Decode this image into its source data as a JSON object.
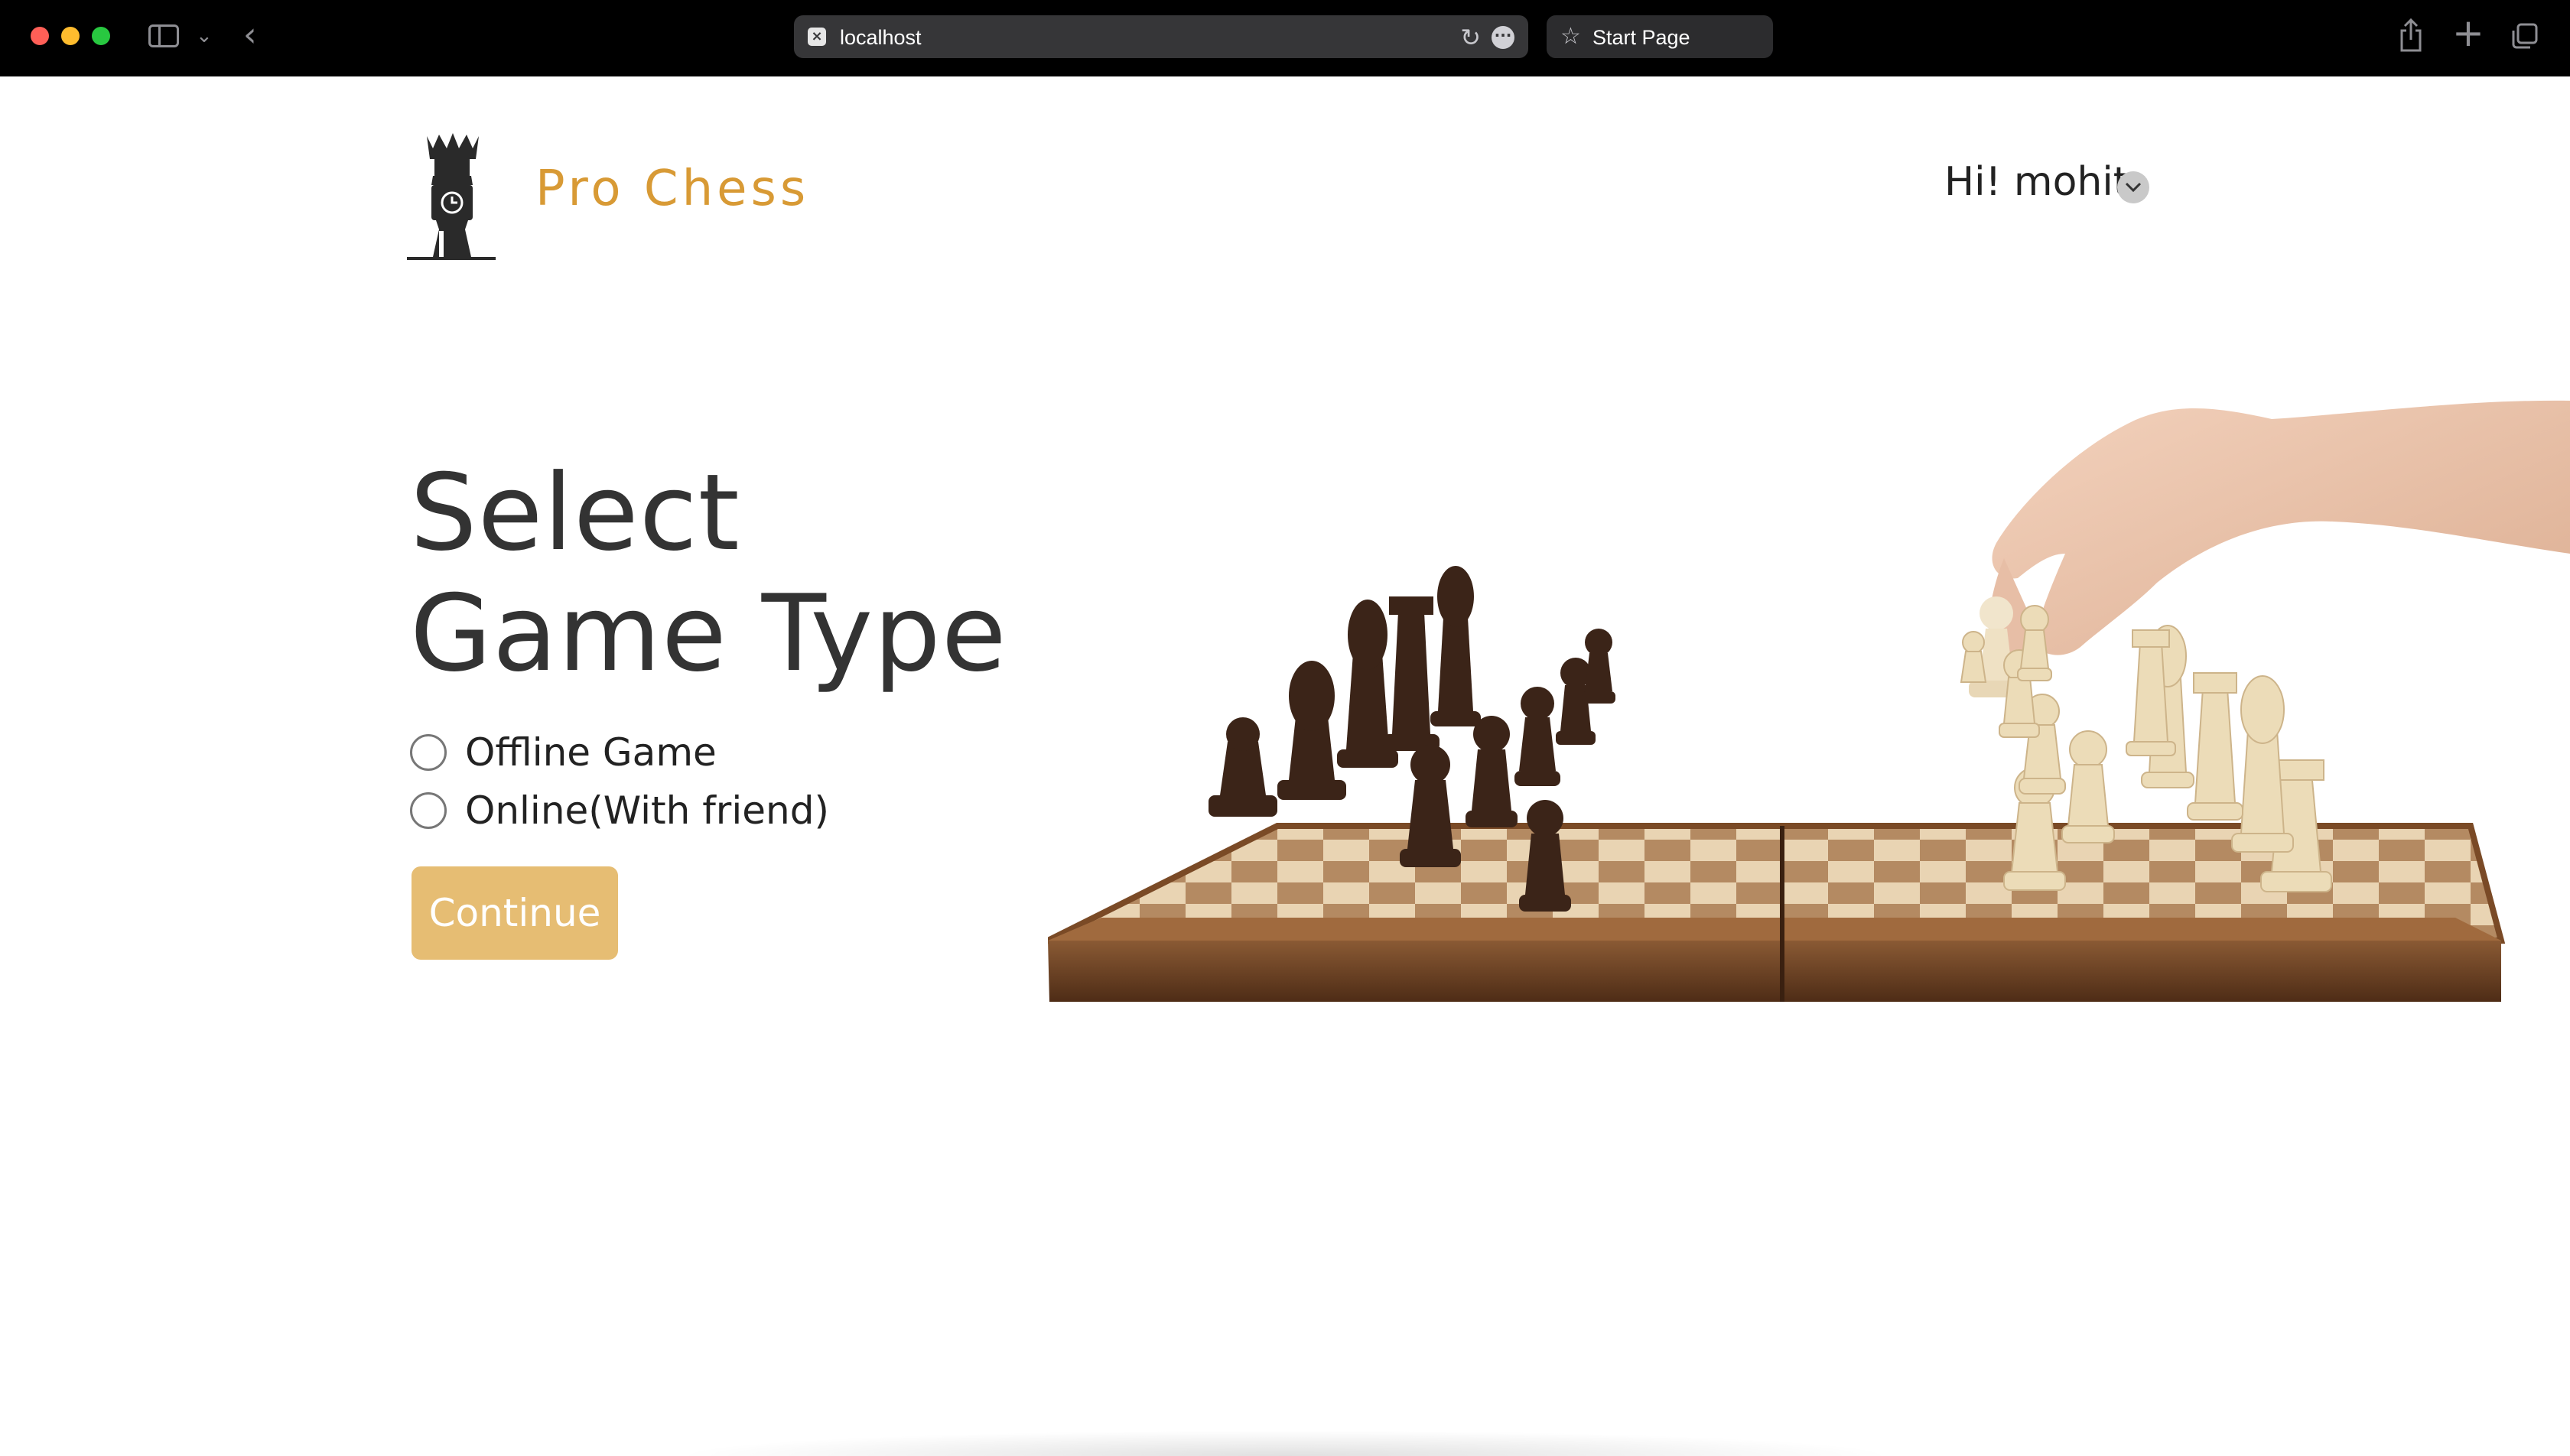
{
  "browser": {
    "url": "localhost",
    "start_page_label": "Start Page",
    "icons": [
      "sidebar-icon",
      "chevron-down-icon",
      "back-arrow-icon",
      "site-favicon-icon",
      "reload-icon",
      "more-icon",
      "star-icon",
      "share-icon",
      "new-tab-icon",
      "tabs-overview-icon"
    ]
  },
  "header": {
    "brand": "Pro Chess",
    "greeting": "Hi! mohit",
    "brand_color": "#d89a35"
  },
  "main": {
    "title_line1": "Select",
    "title_line2": "Game Type",
    "options": [
      {
        "label": "Offline Game",
        "selected": false
      },
      {
        "label": "Online(With friend)",
        "selected": false
      }
    ],
    "continue_label": "Continue",
    "button_color": "#e6bd73"
  },
  "hero": {
    "image_icon": "chess-board-hand-illustration"
  }
}
